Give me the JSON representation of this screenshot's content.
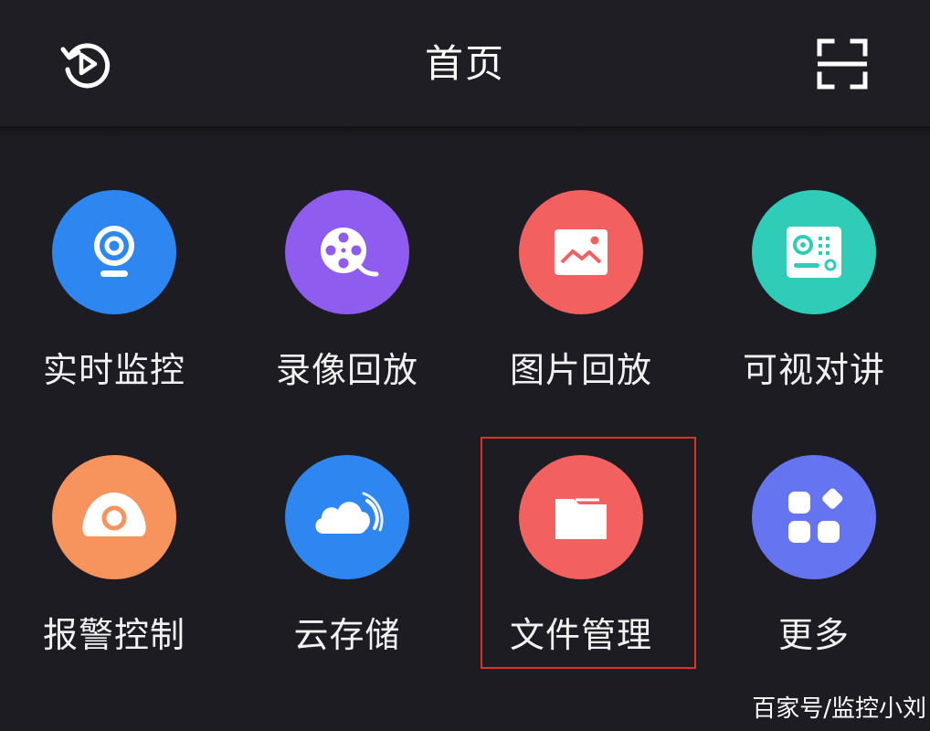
{
  "header": {
    "title": "首页",
    "left_icon": "playback-history-icon",
    "right_icon": "scan-icon"
  },
  "colors": {
    "background": "#1c1c22",
    "header": "#1e1e24",
    "blue": "#2e86f0",
    "purple": "#8f5cf0",
    "coral": "#f2605f",
    "teal": "#2fcdb8",
    "orange": "#f7935c",
    "periwinkle": "#6574f0",
    "highlight_border": "#e0302a"
  },
  "tiles": [
    {
      "label": "实时监控",
      "icon": "camera-icon"
    },
    {
      "label": "录像回放",
      "icon": "film-reel-icon"
    },
    {
      "label": "图片回放",
      "icon": "picture-icon"
    },
    {
      "label": "可视对讲",
      "icon": "intercom-icon"
    },
    {
      "label": "报警控制",
      "icon": "alarm-icon"
    },
    {
      "label": "云存储",
      "icon": "cloud-icon"
    },
    {
      "label": "文件管理",
      "icon": "folder-icon"
    },
    {
      "label": "更多",
      "icon": "more-apps-icon"
    }
  ],
  "watermark": "百家号/监控小刘"
}
